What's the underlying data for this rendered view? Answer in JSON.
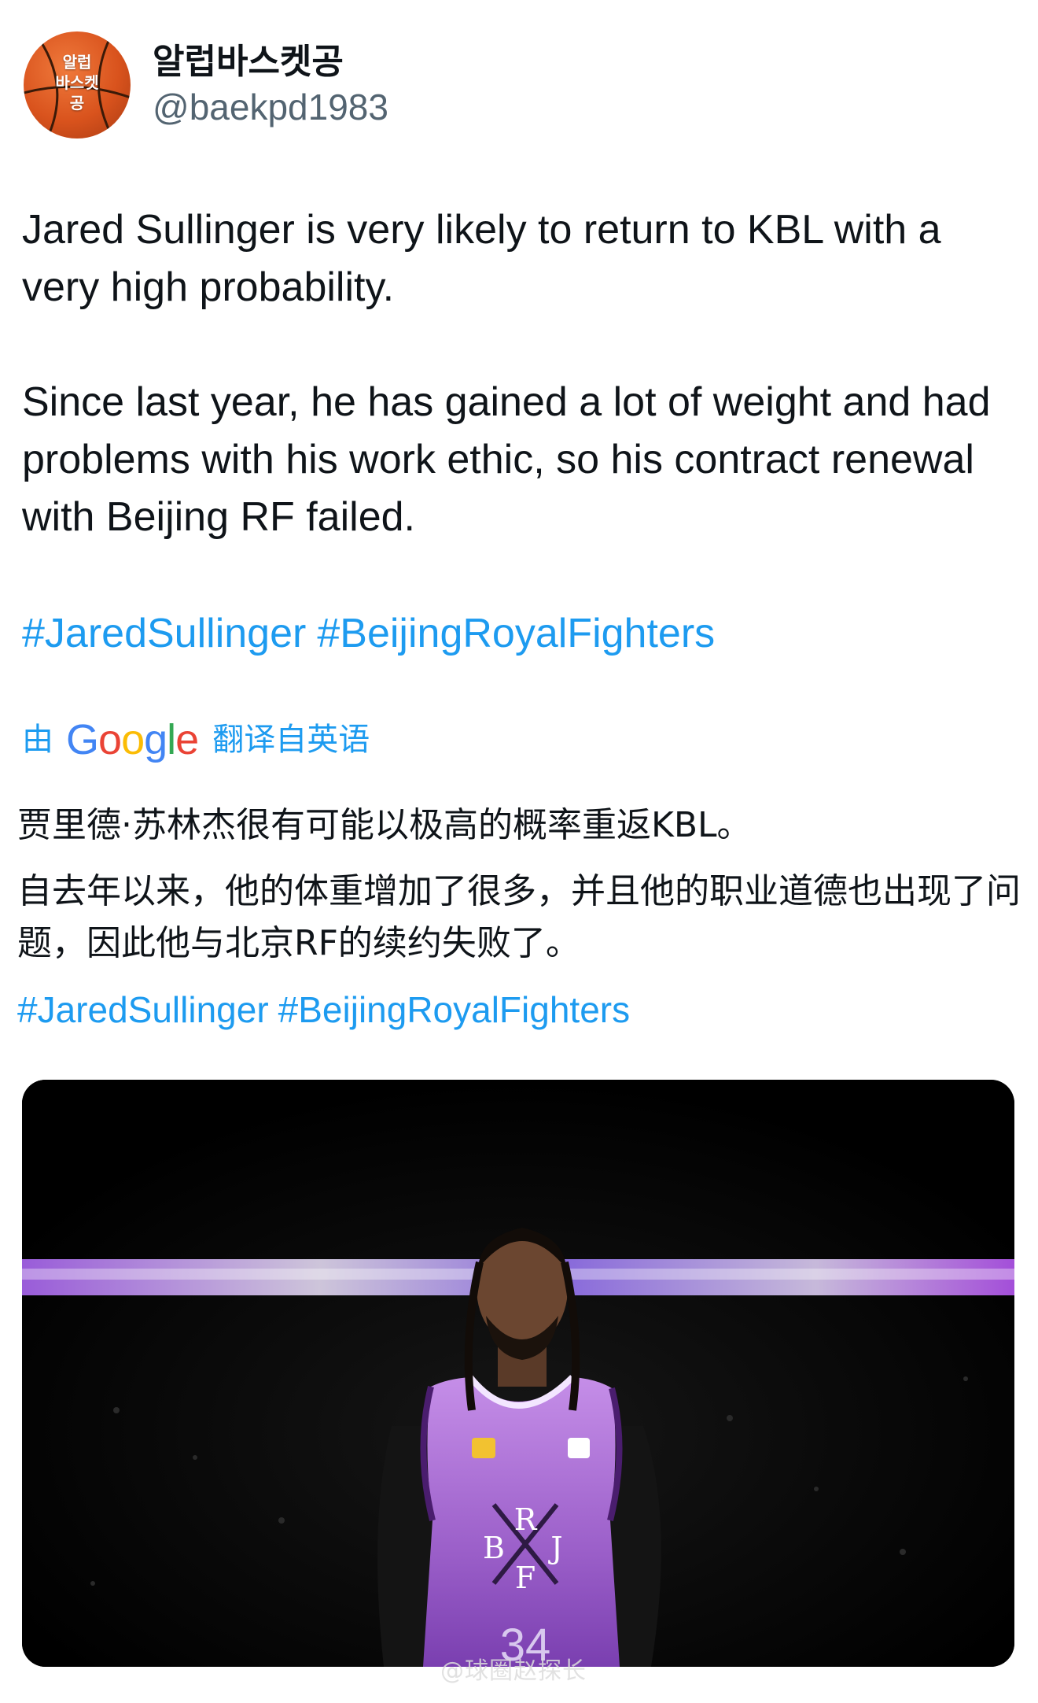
{
  "author": {
    "display_name": "알럽바스켓공",
    "handle": "@baekpd1983",
    "avatar_text": [
      "알럽",
      "바스켓",
      "공"
    ]
  },
  "tweet": {
    "paragraph1": "Jared Sullinger is very likely to return to KBL with a very high probability.",
    "paragraph2": "Since last year, he has gained a lot of weight and had problems with his work ethic, so his contract renewal with Beijing RF failed.",
    "hashtags": [
      "#JaredSullinger",
      "#BeijingRoyalFighters"
    ]
  },
  "translation": {
    "prefix": "由",
    "provider": "Google",
    "suffix": "翻译自英语",
    "line1": "贾里德·苏林杰很有可能以极高的概率重返KBL。",
    "line2": "自去年以来，他的体重增加了很多，并且他的职业道德也出现了问题，因此他与北京RF的续约失败了。",
    "hashtags": [
      "#JaredSullinger",
      "#BeijingRoyalFighters"
    ]
  },
  "media": {
    "jersey_letters": [
      "R",
      "B",
      "J",
      "F"
    ],
    "jersey_number": "34",
    "watermark": "@球圈赵探长"
  },
  "colors": {
    "link": "#1d9bf0",
    "text": "#0f1419",
    "secondary": "#536471",
    "jersey": "#9b5fc9"
  }
}
